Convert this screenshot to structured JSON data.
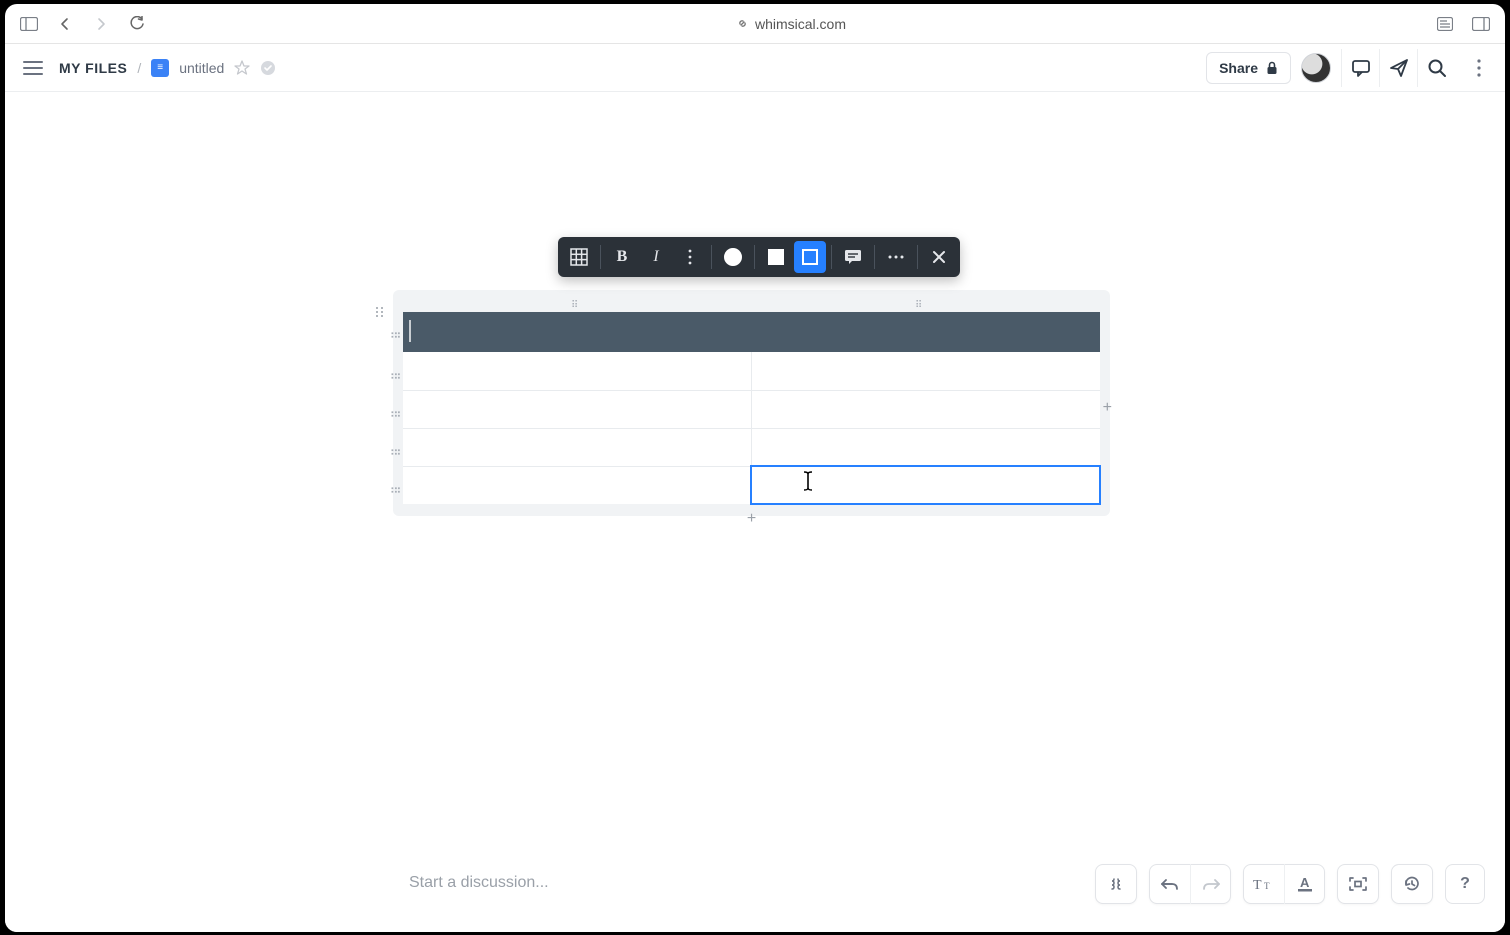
{
  "browser": {
    "url": "whimsical.com"
  },
  "header": {
    "breadcrumb_root": "MY FILES",
    "separator": "/",
    "doc_title": "untitled",
    "share_label": "Share"
  },
  "toolbar": {
    "buttons": [
      "table",
      "bold",
      "italic",
      "more-text",
      "color",
      "fill",
      "outline",
      "comment",
      "more",
      "close"
    ],
    "active": "outline"
  },
  "table": {
    "columns": 2,
    "rows": 5,
    "header_row": true,
    "selected_cell": {
      "row": 4,
      "col": 1
    },
    "cells": [
      [
        "",
        ""
      ],
      [
        "",
        ""
      ],
      [
        "",
        ""
      ],
      [
        "",
        ""
      ],
      [
        "",
        ""
      ]
    ]
  },
  "discussion": {
    "placeholder": "Start a discussion..."
  }
}
